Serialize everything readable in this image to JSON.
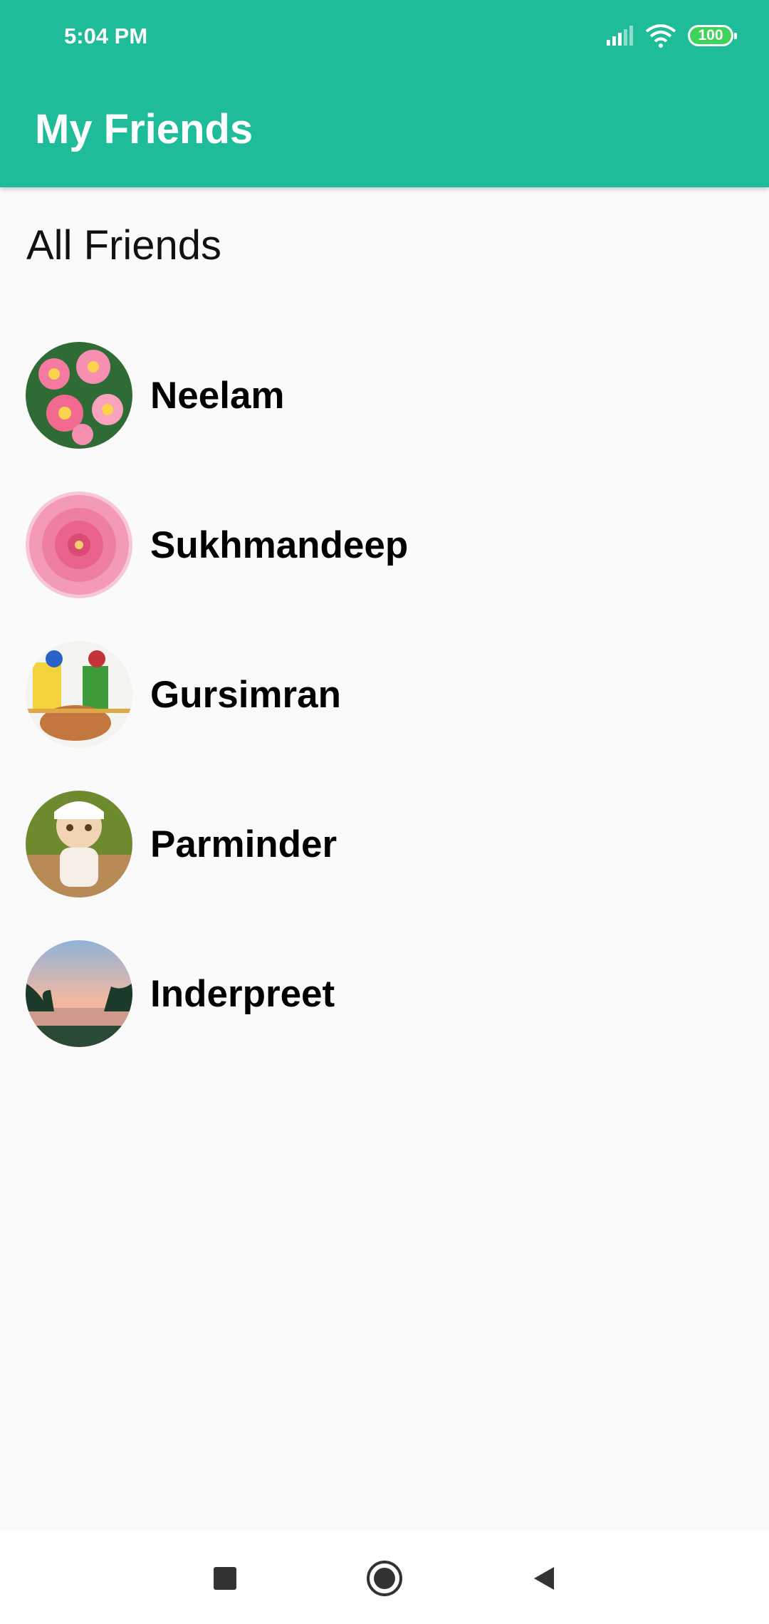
{
  "status_bar": {
    "time": "5:04 PM",
    "battery": "100",
    "icons": [
      "signal-icon",
      "wifi-icon",
      "battery-icon"
    ]
  },
  "app_bar": {
    "title": "My Friends",
    "color": "#1ebc98"
  },
  "section": {
    "title": "All Friends"
  },
  "friends": [
    {
      "name": "Neelam",
      "avatar": "pink-plumeria-flowers"
    },
    {
      "name": "Sukhmandeep",
      "avatar": "pink-dahlia-flower"
    },
    {
      "name": "Gursimran",
      "avatar": "bhangra-dancers-dhol"
    },
    {
      "name": "Parminder",
      "avatar": "doll-with-cat"
    },
    {
      "name": "Inderpreet",
      "avatar": "sunset-lake-palms"
    }
  ],
  "nav_bar": {
    "buttons": [
      "recents-square-icon",
      "home-circle-icon",
      "back-triangle-icon"
    ]
  }
}
